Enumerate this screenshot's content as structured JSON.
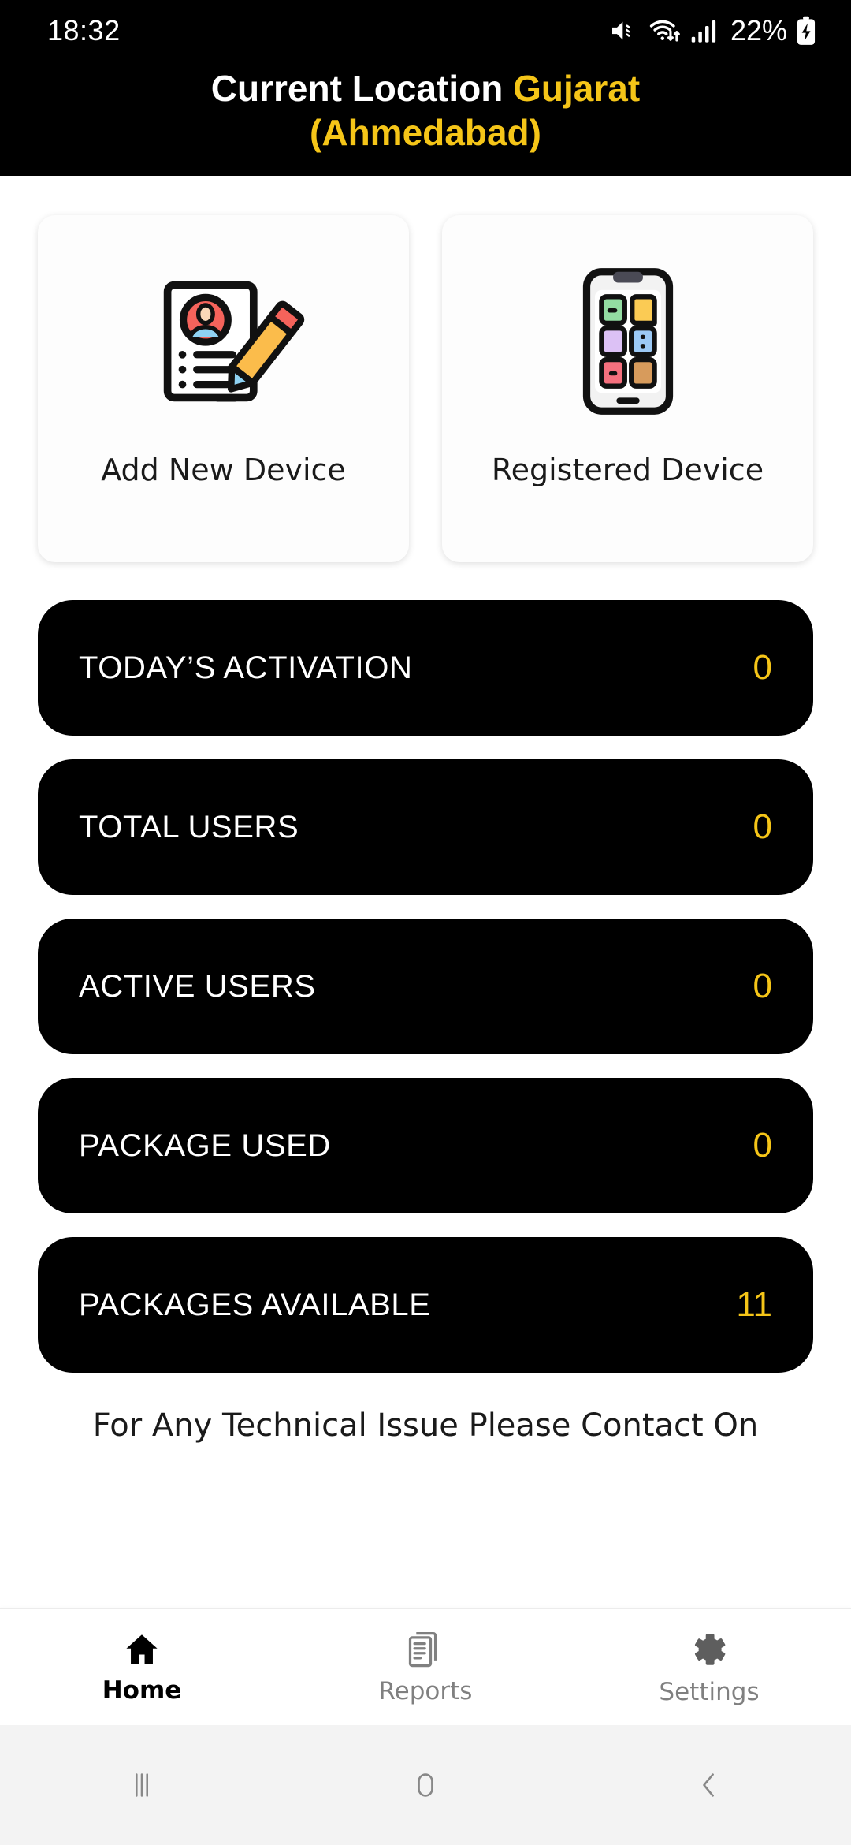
{
  "status_bar": {
    "time": "18:32",
    "battery_percent": "22%",
    "icons": [
      "mute-icon",
      "wifi-icon",
      "signal-icon",
      "battery-charging-icon"
    ]
  },
  "header": {
    "title_prefix": "Current Location",
    "title_state": "Gujarat",
    "title_city": "(Ahmedabad)",
    "accent_color": "#F5C518",
    "background_color": "#000000"
  },
  "shortcuts": [
    {
      "label": "Add New Device",
      "icon": "document-user-pencil-icon"
    },
    {
      "label": "Registered Device",
      "icon": "smartphone-apps-icon"
    }
  ],
  "stats": [
    {
      "label": "TODAY’S ACTIVATION",
      "value": "0"
    },
    {
      "label": "TOTAL USERS",
      "value": "0"
    },
    {
      "label": "ACTIVE USERS",
      "value": "0"
    },
    {
      "label": "PACKAGE USED",
      "value": "0"
    },
    {
      "label": "PACKAGES AVAILABLE",
      "value": "11"
    }
  ],
  "footer": {
    "note": "For Any Technical Issue Please Contact On"
  },
  "bottom_nav": [
    {
      "label": "Home",
      "icon": "home-icon",
      "active": true
    },
    {
      "label": "Reports",
      "icon": "reports-icon",
      "active": false
    },
    {
      "label": "Settings",
      "icon": "gear-icon",
      "active": false
    }
  ],
  "system_nav": [
    {
      "icon": "recents-icon"
    },
    {
      "icon": "home-circle-icon"
    },
    {
      "icon": "back-chevron-icon"
    }
  ]
}
